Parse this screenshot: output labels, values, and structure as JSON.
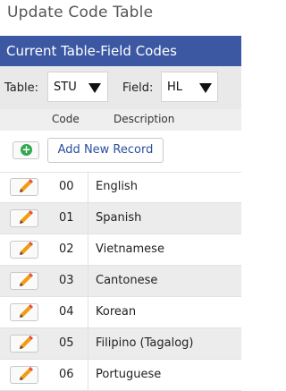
{
  "title": "Update Code Table",
  "section_title": "Current Table-Field Codes",
  "filters": {
    "table_label": "Table:",
    "table_value": "STU",
    "field_label": "Field:",
    "field_value": "HL"
  },
  "columns": {
    "code": "Code",
    "description": "Description"
  },
  "add_button_label": "Add New Record",
  "icons": {
    "add": "add-circle-icon",
    "edit": "pencil-icon",
    "dropdown": "dropdown-arrow-icon"
  },
  "colors": {
    "header_bar": "#3c58a3",
    "add_icon": "#2fa84f",
    "pencil": "#f39c12",
    "link": "#2b4f9e"
  },
  "rows": [
    {
      "code": "00",
      "description": "English"
    },
    {
      "code": "01",
      "description": "Spanish"
    },
    {
      "code": "02",
      "description": "Vietnamese"
    },
    {
      "code": "03",
      "description": "Cantonese"
    },
    {
      "code": "04",
      "description": "Korean"
    },
    {
      "code": "05",
      "description": "Filipino (Tagalog)"
    },
    {
      "code": "06",
      "description": "Portuguese"
    }
  ]
}
